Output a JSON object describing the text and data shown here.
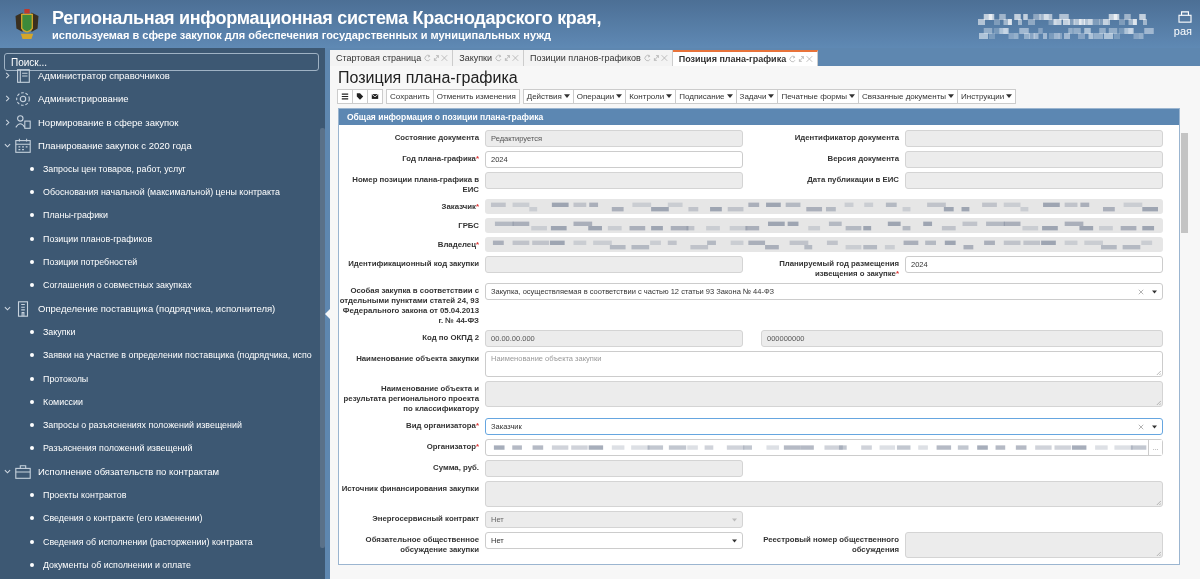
{
  "header": {
    "title": "Региональная информационная система Краснодарского края,",
    "subtitle": "используемая в сфере закупок для обеспечения государственных и муниципальных нужд",
    "user_fragment": "рая"
  },
  "sidebar": {
    "search": {
      "placeholder": "Поиск..."
    },
    "items": [
      {
        "label": "Администратор справочников",
        "expanded": false
      },
      {
        "label": "Администрирование",
        "expanded": false
      },
      {
        "label": "Нормирование в сфере закупок",
        "expanded": false
      },
      {
        "label": "Планирование закупок с 2020 года",
        "expanded": true,
        "children": [
          {
            "label": "Запросы цен товаров, работ, услуг"
          },
          {
            "label": "Обоснования начальной (максимальной) цены контракта"
          },
          {
            "label": "Планы-графики"
          },
          {
            "label": "Позиции планов-графиков"
          },
          {
            "label": "Позиции потребностей"
          },
          {
            "label": "Соглашения о совместных закупках"
          }
        ]
      },
      {
        "label": "Определение поставщика (подрядчика, исполнителя)",
        "expanded": true,
        "children": [
          {
            "label": "Закупки"
          },
          {
            "label": "Заявки на участие в определении поставщика (подрядчика, испо"
          },
          {
            "label": "Протоколы"
          },
          {
            "label": "Комиссии"
          },
          {
            "label": "Запросы о разъяснениях положений извещений"
          },
          {
            "label": "Разъяснения положений извещений"
          }
        ]
      },
      {
        "label": "Исполнение обязательств по контрактам",
        "expanded": true,
        "children": [
          {
            "label": "Проекты контрактов"
          },
          {
            "label": "Сведения о контракте (его изменении)"
          },
          {
            "label": "Сведения об исполнении (расторжении) контракта"
          },
          {
            "label": "Документы об исполнении и оплате"
          }
        ]
      }
    ]
  },
  "tabs": [
    {
      "label": "Стартовая страница",
      "selected": false
    },
    {
      "label": "Закупки",
      "selected": false
    },
    {
      "label": "Позиции планов-графиков",
      "selected": false
    },
    {
      "label": "Позиция плана-графика",
      "selected": true
    }
  ],
  "page_title": "Позиция плана-графика",
  "toolbar": [
    {
      "label": "Сохранить",
      "dropdown": false
    },
    {
      "label": "Отменить изменения",
      "dropdown": false
    },
    {
      "label": "Действия",
      "dropdown": true
    },
    {
      "label": "Операции",
      "dropdown": true
    },
    {
      "label": "Контроли",
      "dropdown": true
    },
    {
      "label": "Подписание",
      "dropdown": true
    },
    {
      "label": "Задачи",
      "dropdown": true
    },
    {
      "label": "Печатные формы",
      "dropdown": true
    },
    {
      "label": "Связанные документы",
      "dropdown": true
    },
    {
      "label": "Инструкции",
      "dropdown": true
    }
  ],
  "panel": {
    "title": "Общая информация о позиции плана-графика",
    "rows": [
      {
        "kind": "pair",
        "left": {
          "label": "Состояние документа",
          "kind": "input",
          "value": "Редактируется",
          "disabled": true
        },
        "right": {
          "label": "Идентификатор документа",
          "kind": "input",
          "disabled": true
        }
      },
      {
        "kind": "pair",
        "left": {
          "label": "Год плана-графика",
          "required_mark": "*",
          "kind": "input",
          "value": "2024",
          "disabled": false
        },
        "right": {
          "label": "Версия документа",
          "kind": "input",
          "disabled": true
        }
      },
      {
        "kind": "pair",
        "left": {
          "label": "Номер позиции плана-графика в ЕИС",
          "kind": "input",
          "disabled": true
        },
        "right": {
          "label": "Дата публикации в ЕИС",
          "kind": "input",
          "disabled": true
        }
      },
      {
        "kind": "full",
        "left": {
          "label": "Заказчик",
          "required_mark": "*",
          "kind": "redacted",
          "disabled": true
        }
      },
      {
        "kind": "full",
        "left": {
          "label": "ГРБС",
          "kind": "redacted",
          "disabled": true
        }
      },
      {
        "kind": "full",
        "left": {
          "label": "Владелец",
          "required_mark": "*",
          "kind": "redacted",
          "disabled": true
        }
      },
      {
        "kind": "pair",
        "left": {
          "label": "Идентификационный код закупки",
          "kind": "input",
          "disabled": true
        },
        "right": {
          "label": "Планируемый год размещения извещения о закупке",
          "required_mark": "*",
          "kind": "input",
          "value": "2024",
          "disabled": false
        }
      },
      {
        "kind": "full",
        "left": {
          "label": "Особая закупка в соответствии с отдельными пунктами статей 24, 93 Федерального закона от 05.04.2013 г. № 44-ФЗ",
          "kind": "select",
          "value": "Закупка, осуществляемая в соответствии с частью 12 статьи 93 Закона № 44-ФЗ",
          "disabled": false,
          "clearable": true,
          "focused": false
        }
      },
      {
        "kind": "split",
        "left": {
          "label": "Код по ОКПД 2",
          "kind": "input",
          "value": "00.00.00.000",
          "disabled": true
        },
        "second": {
          "kind": "input",
          "value": "000000000",
          "disabled": true
        }
      },
      {
        "kind": "full",
        "left": {
          "label": "Наименование объекта закупки",
          "kind": "textarea",
          "placeholder": "Наименование объекта закупки",
          "disabled": false
        }
      },
      {
        "kind": "full",
        "left": {
          "label": "Наименование объекта и результата регионального проекта по классификатору",
          "kind": "textarea",
          "disabled": true
        }
      },
      {
        "kind": "full",
        "left": {
          "label": "Вид организатора",
          "required_mark": "*",
          "kind": "select",
          "value": "Заказчик",
          "disabled": false,
          "clearable": true,
          "focused": true
        }
      },
      {
        "kind": "full",
        "left": {
          "label": "Организатор",
          "required_mark": "*",
          "kind": "lookup",
          "lookup_button": "...",
          "disabled": false
        }
      },
      {
        "kind": "pair",
        "left": {
          "label": "Сумма, руб.",
          "kind": "input",
          "disabled": true
        }
      },
      {
        "kind": "full",
        "left": {
          "label": "Источник финансирования закупки",
          "kind": "textarea",
          "disabled": true
        }
      },
      {
        "kind": "pair",
        "left": {
          "label": "Энергосервисный контракт",
          "kind": "select",
          "value": "Нет",
          "disabled": true,
          "focused": false
        }
      },
      {
        "kind": "pair",
        "left": {
          "label": "Обязательное общественное обсуждение закупки",
          "kind": "select",
          "value": "Нет",
          "disabled": false,
          "focused": false
        },
        "right": {
          "label": "Реестровый номер общественного обсуждения",
          "kind": "textarea",
          "disabled": true
        }
      }
    ]
  }
}
